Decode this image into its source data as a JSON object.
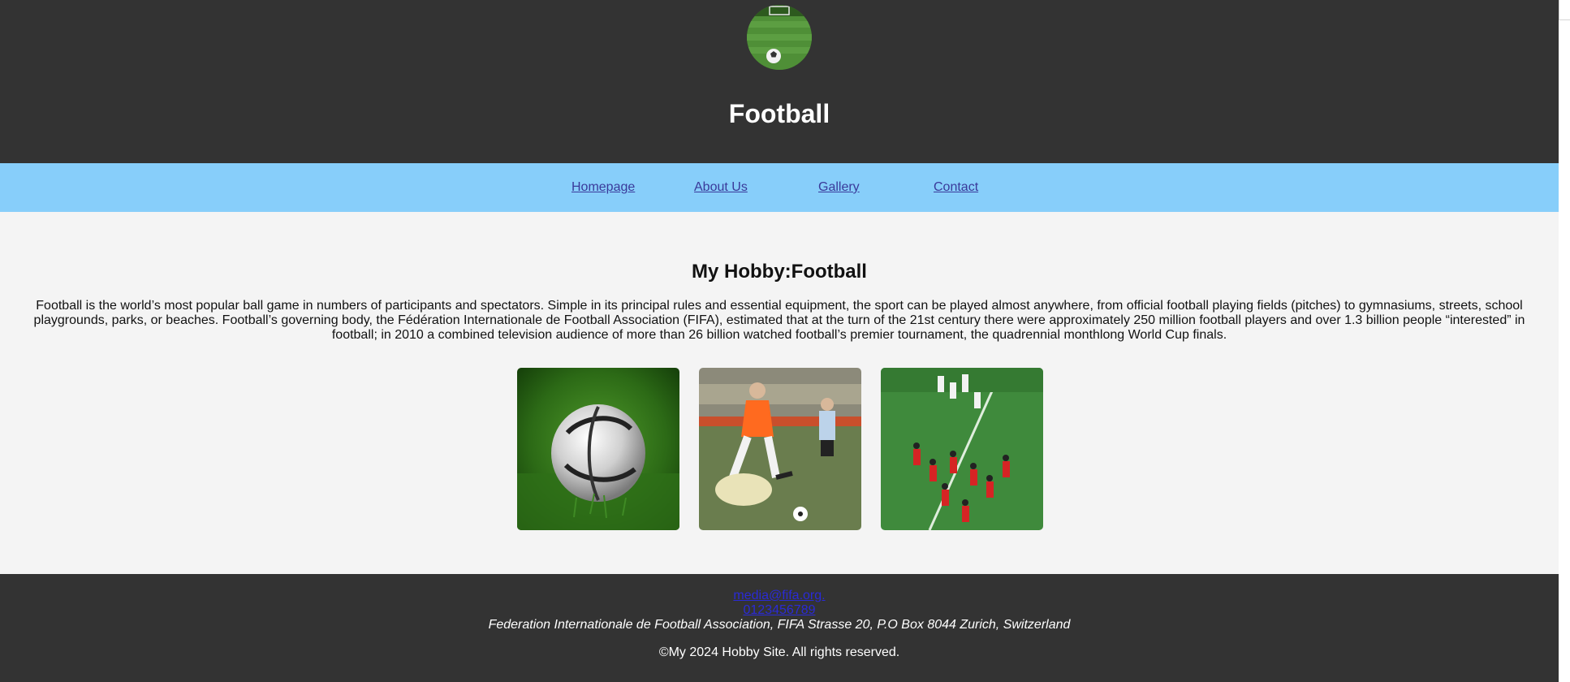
{
  "header": {
    "logo_icon": "football-field-logo",
    "title": "Football"
  },
  "nav": {
    "items": [
      {
        "label": "Homepage"
      },
      {
        "label": "About Us"
      },
      {
        "label": "Gallery"
      },
      {
        "label": "Contact"
      }
    ]
  },
  "main": {
    "title": "My Hobby:Football",
    "intro": "Football is the world’s most popular ball game in numbers of participants and spectators. Simple in its principal rules and essential equipment, the sport can be played almost anywhere, from official football playing fields (pitches) to gymnasiums, streets, school playgrounds, parks, or beaches. Football’s governing body, the Fédération Internationale de Football Association (FIFA), estimated that at the turn of the 21st century there were approximately 250 million football players and over 1.3 billion people “interested” in football; in 2010 a combined television audience of more than 26 billion watched football’s premier tournament, the quadrennial monthlong World Cup finals.",
    "gallery": [
      {
        "icon": "football-on-grass-image"
      },
      {
        "icon": "player-kicking-ball-image"
      },
      {
        "icon": "team-on-pitch-image"
      }
    ]
  },
  "footer": {
    "email": "media@fifa.org.",
    "phone": "0123456789",
    "address": "Federation Internationale de Football Association, FIFA Strasse 20, P.O Box 8044 Zurich, Switzerland",
    "copyright": "©My 2024 Hobby Site. All rights reserved."
  },
  "colors": {
    "header_bg": "#333333",
    "nav_bg": "#87cefa",
    "body_bg": "#f4f4f4",
    "link": "#3a3a9a"
  }
}
